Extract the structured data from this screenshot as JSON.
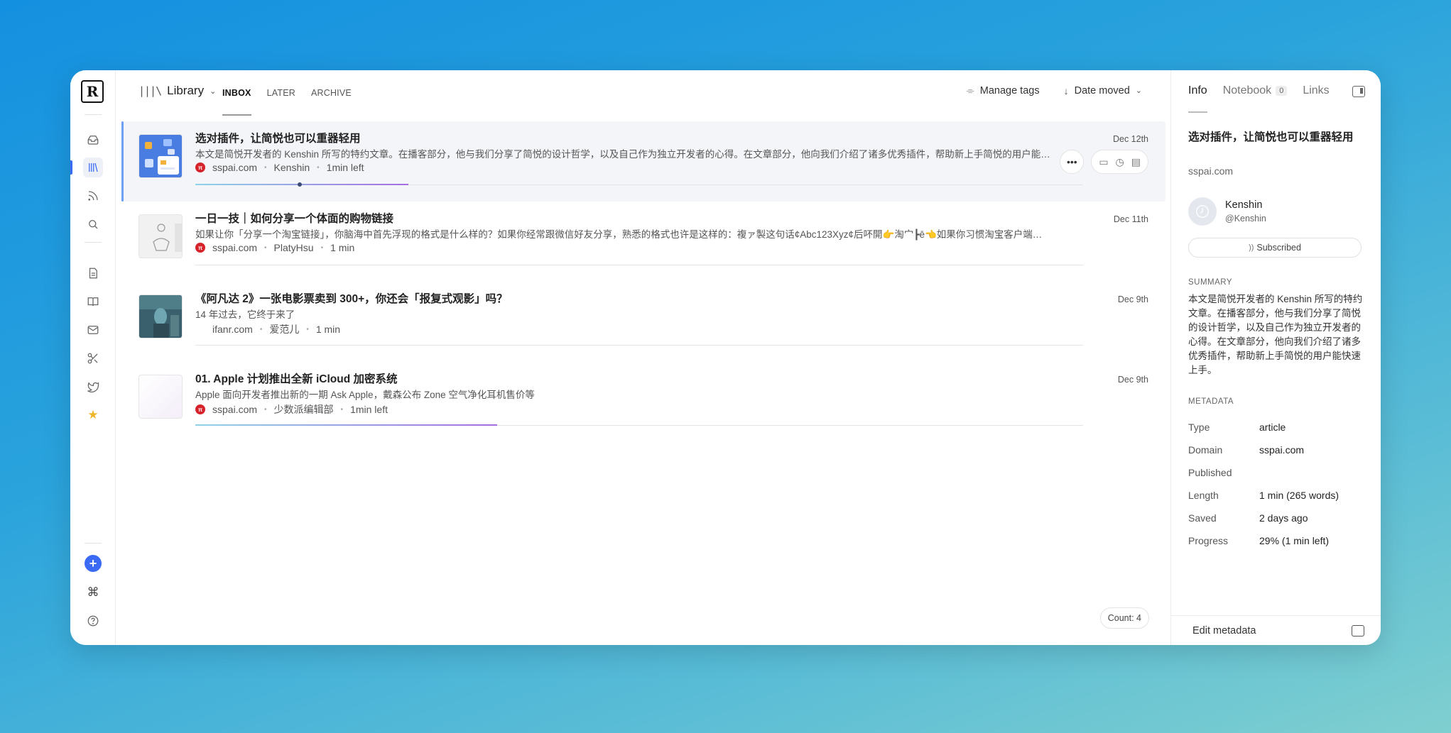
{
  "app": {
    "logo": "R",
    "rail_icons": [
      "home-icon",
      "library-icon",
      "feed-icon",
      "search-icon",
      "document-icon",
      "book-icon",
      "mail-icon",
      "clip-icon",
      "twitter-icon",
      "star-icon",
      "plus-icon",
      "command-icon",
      "help-icon"
    ]
  },
  "topbar": {
    "library_icon": "|||\\",
    "library_label": "Library",
    "tabs": [
      "INBOX",
      "LATER",
      "ARCHIVE"
    ],
    "manage_tags": "Manage tags",
    "sort_label": "Date moved"
  },
  "items": [
    {
      "title": "选对插件，让简悦也可以重器轻用",
      "desc": "本文是简悦开发者的 Kenshin 所写的特约文章。在播客部分，他与我们分享了简悦的设计哲学，以及自己作为独立开发者的心得。在文章部分，他向我们介绍了诸多优秀插件，帮助新上手简悦的用户能快速上手。",
      "domain": "sspai.com",
      "author": "Kenshin",
      "time": "1min left",
      "date": "Dec 12th",
      "progress": 0.24,
      "favicon": "π"
    },
    {
      "title": "一日一技｜如何分享一个体面的购物链接",
      "desc": "如果让你「分享一个淘宝链接」，你脑海中首先浮现的格式是什么样的？如果你经常跟微信好友分享，熟悉的格式也许是这样的：複ァ製这句话¢Abc123Xyz¢后吥開👉淘宀┣ē👈如果你习惯淘宝客户端…",
      "domain": "sspai.com",
      "author": "PlatyHsu",
      "time": "1 min",
      "date": "Dec 11th",
      "favicon": "π"
    },
    {
      "title": "《阿凡达 2》一张电影票卖到 300+，你还会「报复式观影」吗？",
      "desc": "14 年过去，它终于来了",
      "domain": "ifanr.com",
      "author": "爱范儿",
      "time": "1 min",
      "date": "Dec 9th",
      "favicon": ""
    },
    {
      "title": "01. Apple 计划推出全新 iCloud 加密系统",
      "desc": "Apple 面向开发者推出新的一期 Ask Apple，戴森公布 Zone 空气净化耳机售价等",
      "domain": "sspai.com",
      "author": "少数派编辑部",
      "time": "1min left",
      "date": "Dec 9th",
      "progress": 0.34,
      "favicon": "π"
    }
  ],
  "count_label": "Count: 4",
  "panel": {
    "tabs": {
      "info": "Info",
      "notebook": "Notebook",
      "notebook_count": "0",
      "links": "Links"
    },
    "title": "选对插件，让简悦也可以重器轻用",
    "domain": "sspai.com",
    "author_name": "Kenshin",
    "author_handle": "@Kenshin",
    "subscribed": "Subscribed",
    "summary_heading": "SUMMARY",
    "summary": "本文是简悦开发者的 Kenshin 所写的特约文章。在播客部分，他与我们分享了简悦的设计哲学，以及自己作为独立开发者的心得。在文章部分，他向我们介绍了诸多优秀插件，帮助新上手简悦的用户能快速上手。",
    "metadata_heading": "METADATA",
    "metadata": [
      {
        "k": "Type",
        "v": "article"
      },
      {
        "k": "Domain",
        "v": "sspai.com"
      },
      {
        "k": "Published",
        "v": ""
      },
      {
        "k": "Length",
        "v": "1 min (265 words)"
      },
      {
        "k": "Saved",
        "v": "2 days ago"
      },
      {
        "k": "Progress",
        "v": "29% (1 min left)"
      }
    ],
    "edit_metadata": "Edit metadata"
  }
}
